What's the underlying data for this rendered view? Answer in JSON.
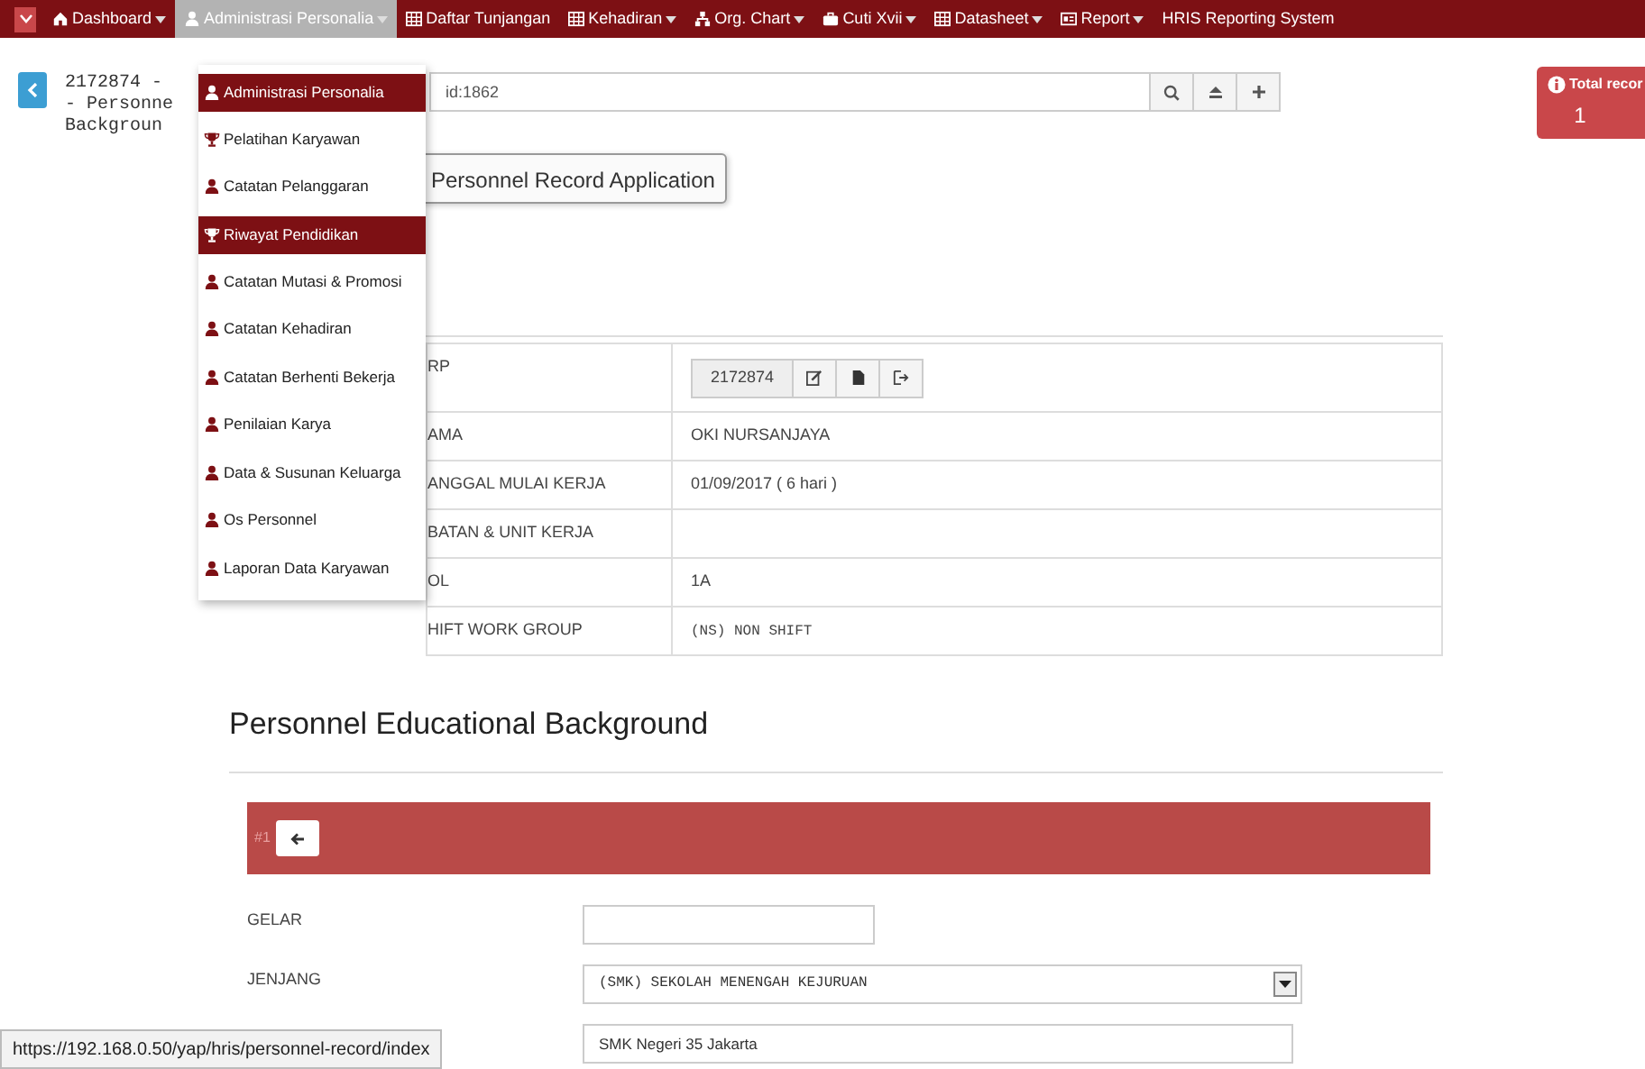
{
  "nav": {
    "items": [
      {
        "label": "Dashboard",
        "kind": "home",
        "caret": true,
        "selected": false
      },
      {
        "label": "Administrasi Personalia",
        "kind": "person",
        "caret": true,
        "selected": true
      },
      {
        "label": "Daftar Tunjangan",
        "kind": "grid",
        "caret": false,
        "selected": false
      },
      {
        "label": "Kehadiran",
        "kind": "grid",
        "caret": true,
        "selected": false
      },
      {
        "label": "Org. Chart",
        "kind": "sitemap",
        "caret": true,
        "selected": false
      },
      {
        "label": "Cuti Xvii",
        "kind": "briefcase",
        "caret": true,
        "selected": false
      },
      {
        "label": "Datasheet",
        "kind": "grid",
        "caret": true,
        "selected": false
      },
      {
        "label": "Report",
        "kind": "card",
        "caret": true,
        "selected": false
      },
      {
        "label": "HRIS Reporting System",
        "kind": "none",
        "caret": false,
        "selected": false
      }
    ]
  },
  "record": {
    "title_lines": [
      "2172874 -",
      "- Personne",
      "Backgroun"
    ],
    "search_value": "id:1862"
  },
  "total": {
    "label": "Total recor",
    "value": "1"
  },
  "tooltip": "Personnel Record Application",
  "menu": [
    {
      "label": "Administrasi Personalia",
      "kind": "person",
      "highlighted": true
    },
    {
      "label": "Pelatihan Karyawan",
      "kind": "trophy",
      "highlighted": false
    },
    {
      "label": "Catatan Pelanggaran",
      "kind": "person",
      "highlighted": false
    },
    {
      "label": "Riwayat Pendidikan",
      "kind": "trophy",
      "highlighted": true
    },
    {
      "label": "Catatan Mutasi & Promosi",
      "kind": "person",
      "highlighted": false
    },
    {
      "label": "Catatan Kehadiran",
      "kind": "person",
      "highlighted": false
    },
    {
      "label": "Catatan Berhenti Bekerja",
      "kind": "person",
      "highlighted": false
    },
    {
      "label": "Penilaian Karya",
      "kind": "person",
      "highlighted": false
    },
    {
      "label": "Data & Susunan Keluarga",
      "kind": "person",
      "highlighted": false
    },
    {
      "label": "Os Personnel",
      "kind": "person",
      "highlighted": false
    },
    {
      "label": "Laporan Data Karyawan",
      "kind": "person",
      "highlighted": false
    }
  ],
  "profile": [
    {
      "label": "RP",
      "value": "2172874",
      "kind": "id"
    },
    {
      "label": "AMA",
      "value": "OKI NURSANJAYA",
      "kind": "text"
    },
    {
      "label": "ANGGAL MULAI KERJA",
      "value": "01/09/2017 ( 6 hari )",
      "kind": "text"
    },
    {
      "label": "BATAN & UNIT KERJA",
      "kind": "text"
    },
    {
      "label": "OL",
      "value": "1A",
      "kind": "text"
    },
    {
      "label": "HIFT WORK GROUP",
      "value": "(NS) NON SHIFT",
      "kind": "mono"
    }
  ],
  "education": {
    "heading": "Personnel Educational Background",
    "record_number": "#1",
    "fields": [
      {
        "label": "GELAR",
        "kind": "input"
      },
      {
        "label": "JENJANG",
        "kind": "select",
        "value": "(SMK) SEKOLAH MENENGAH KEJURUAN"
      },
      {
        "kind": "input",
        "value": "SMK Negeri 35 Jakarta"
      }
    ]
  },
  "status_bar": "https://192.168.0.50/yap/hris/personnel-record/index"
}
